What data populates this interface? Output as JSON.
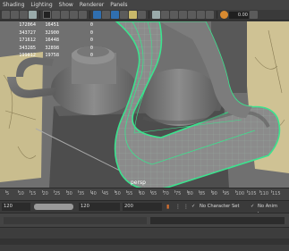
{
  "menu": [
    "Shading",
    "Lighting",
    "Show",
    "Renderer",
    "Panels"
  ],
  "toolbar": {
    "exposure_value": "0.00",
    "icons": [
      "camera-icon",
      "bookmark-icon",
      "grid-icon",
      "film-gate-icon",
      "resolution-gate-icon",
      "wireframe-icon",
      "smooth-shade-icon",
      "textured-icon",
      "lights-icon",
      "shadows-icon",
      "isolate-icon",
      "xray-icon",
      "ambient-occlusion-icon",
      "motion-blur-icon",
      "anti-alias-icon",
      "depth-of-field-icon",
      "color-management-icon"
    ]
  },
  "hud": {
    "rows": [
      [
        "172064",
        "16451",
        "0"
      ],
      [
        "343727",
        "32900",
        "0"
      ],
      [
        "171612",
        "16448",
        "0"
      ],
      [
        "343285",
        "32898",
        "0"
      ],
      [
        "199812",
        "19758",
        "0"
      ]
    ]
  },
  "viewport": {
    "camera_label": "persp"
  },
  "timeslider": {
    "ticks": [
      "5",
      "10",
      "15",
      "20",
      "25",
      "30",
      "35",
      "40",
      "45",
      "50",
      "55",
      "60",
      "65",
      "70",
      "75",
      "80",
      "85",
      "90",
      "95",
      "100",
      "105",
      "110",
      "115"
    ]
  },
  "range": {
    "start": "120",
    "end": "120",
    "anim_end": "200",
    "character_set": "No Character Set",
    "anim_layer": "No Anim Layer"
  },
  "colors": {
    "accent_green": "#3be38e",
    "panel_bg": "#3c3c3c",
    "viewport_bg": "#6d6d6d"
  }
}
